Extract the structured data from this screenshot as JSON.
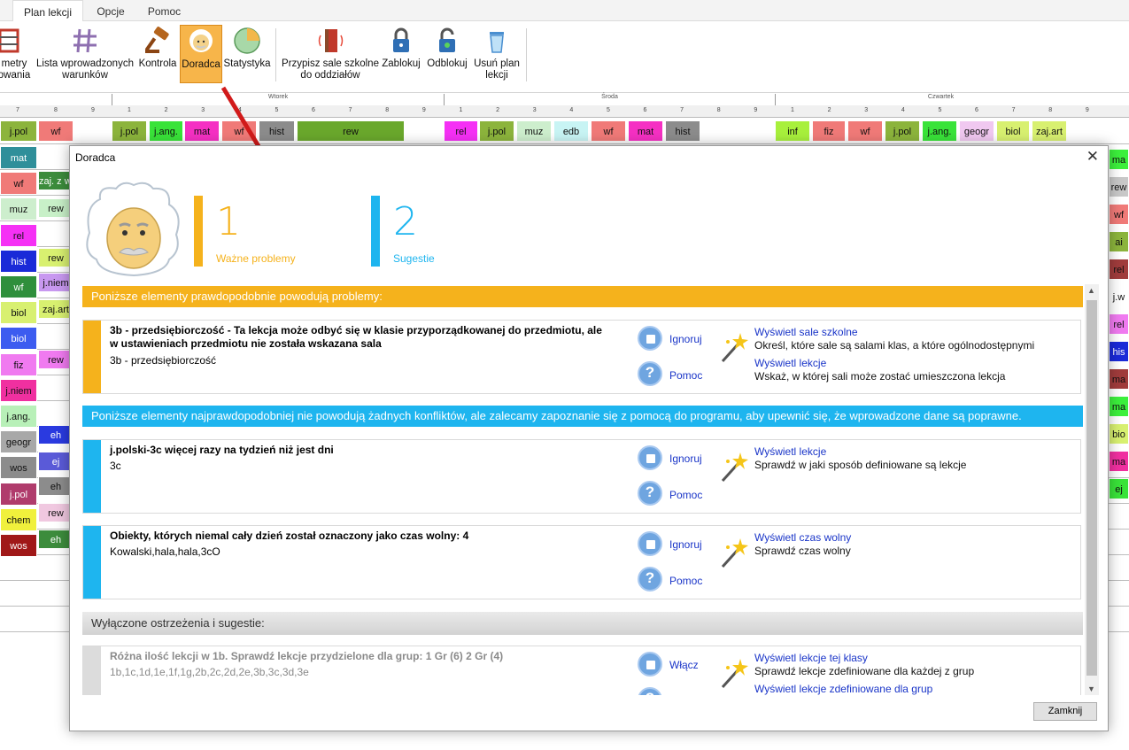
{
  "tabs": [
    "Plan lekcji",
    "Opcje",
    "Pomoc"
  ],
  "ribbon": {
    "params_label_1": "metry",
    "params_label_2": "owania",
    "conditions_label_1": "Lista wprowadzonych",
    "conditions_label_2": "warunków",
    "control_label": "Kontrola",
    "advisor_label": "Doradca",
    "stats_label": "Statystyka",
    "assign_rooms_label_1": "Przypisz sale szkolne",
    "assign_rooms_label_2": "do oddziałów",
    "lock_label": "Zablokuj",
    "unlock_label": "Odblokuj",
    "delete_label_1": "Usuń plan",
    "delete_label_2": "lekcji"
  },
  "grid": {
    "days": [
      "Wtorek",
      "Środa",
      "Czwartek"
    ],
    "row1": [
      {
        "t": "j.pol",
        "c": "#8cb43c"
      },
      {
        "t": "wf",
        "c": "#f07a78"
      },
      {
        "t": "j.pol",
        "c": "#8cb43c"
      },
      {
        "t": "j.ang.",
        "c": "#39e339"
      },
      {
        "t": "mat",
        "c": "#f530c3"
      },
      {
        "t": "wf",
        "c": "#f07a78"
      },
      {
        "t": "hist",
        "c": "#8c8c8c"
      },
      {
        "t": "rew",
        "c": "#6aa82c"
      },
      {
        "t": "rel",
        "c": "#f530f5"
      },
      {
        "t": "j.pol",
        "c": "#8cb43c"
      },
      {
        "t": "muz",
        "c": "#cdeecd"
      },
      {
        "t": "edb",
        "c": "#c8f4f4"
      },
      {
        "t": "wf",
        "c": "#f07a78"
      },
      {
        "t": "mat",
        "c": "#f530c3"
      },
      {
        "t": "hist",
        "c": "#8c8c8c"
      },
      {
        "t": "inf",
        "c": "#a8f03c"
      },
      {
        "t": "fiz",
        "c": "#f07a78"
      },
      {
        "t": "wf",
        "c": "#f07a78"
      },
      {
        "t": "j.pol",
        "c": "#8cb43c"
      },
      {
        "t": "j.ang.",
        "c": "#39e339"
      },
      {
        "t": "geogr",
        "c": "#f0c8f0"
      },
      {
        "t": "biol",
        "c": "#d8f070"
      },
      {
        "t": "zaj.art",
        "c": "#d8f070"
      }
    ],
    "left_col": [
      {
        "t": "mat",
        "c": "#2f8f9a"
      },
      {
        "t": "wf",
        "c": "#f07a78"
      },
      {
        "t": "muz",
        "c": "#cdeecd"
      },
      {
        "t": "rel",
        "c": "#f530f5"
      },
      {
        "t": "hist",
        "c": "#1a2ad8"
      },
      {
        "t": "wf",
        "c": "#2f8f3c"
      },
      {
        "t": "biol",
        "c": "#d8f070"
      },
      {
        "t": "biol",
        "c": "#3c5cf0"
      },
      {
        "t": "fiz",
        "c": "#f07af0"
      },
      {
        "t": "j.niem",
        "c": "#f030a0"
      },
      {
        "t": "j.ang.",
        "c": "#b8f0b8"
      },
      {
        "t": "geogr",
        "c": "#a8a8a8"
      },
      {
        "t": "wos",
        "c": "#8c8c8c"
      },
      {
        "t": "j.pol",
        "c": "#b03c6c"
      },
      {
        "t": "chem",
        "c": "#f0f03c"
      },
      {
        "t": "wos",
        "c": "#a01818"
      }
    ],
    "second_col": [
      {
        "t": "zaj. z wych",
        "c": "#3c8c3c"
      },
      {
        "t": "rew",
        "c": "#c8f0c8"
      },
      {
        "t": "rew",
        "c": "#d8f070"
      },
      {
        "t": "j.niem",
        "c": "#c898f0"
      },
      {
        "t": "zaj.art",
        "c": "#d8f070"
      },
      {
        "t": "rew",
        "c": "#f07af0"
      },
      {
        "t": "eh",
        "c": "#2a3ae0"
      },
      {
        "t": "ej",
        "c": "#5a5ad8"
      },
      {
        "t": "eh",
        "c": "#8c8c8c"
      },
      {
        "t": "rew",
        "c": "#f0c8e0"
      },
      {
        "t": "eh",
        "c": "#3c8c3c"
      }
    ],
    "right_col": [
      "ma",
      "rew",
      "wf",
      "ai",
      "rel",
      "j.w",
      "rel",
      "his",
      "ma",
      "ma",
      "bio",
      "ma",
      "ej"
    ]
  },
  "dialog": {
    "title": "Doradca",
    "stat_important_num": "1",
    "stat_important_label": "Ważne problemy",
    "stat_suggest_num": "2",
    "stat_suggest_label": "Sugestie",
    "section_problems": "Poniższe elementy prawdopodobnie powodują problemy:",
    "section_suggest": "Poniższe elementy najprawdopodobniej nie powodują żadnych konfliktów, ale zalecamy zapoznanie się z pomocą do programu, aby upewnić się, że wprowadzone dane są poprawne.",
    "section_disabled": "Wyłączone ostrzeżenia i sugestie:",
    "cards": [
      {
        "title": "3b - przedsiębiorczość - Ta lekcja może odbyć się w klasie przyporządkowanej do przedmiotu, ale w ustawieniach przedmiotu nie została wskazana sala",
        "sub": "3b - przedsiębiorczość",
        "action1": "Ignoruj",
        "action2": "Pomoc",
        "link1": "Wyświetl sale szkolne",
        "desc1": "Określ, które sale są salami klas, a które ogólnodostępnymi",
        "link2": "Wyświetl lekcje",
        "desc2": "Wskaż, w której sali może zostać umieszczona lekcja"
      },
      {
        "title": "j.polski-3c więcej razy na tydzień niż jest dni",
        "sub": "3c",
        "action1": "Ignoruj",
        "action2": "Pomoc",
        "link1": "Wyświetl lekcje",
        "desc1": "Sprawdź w jaki sposób definiowane są lekcje"
      },
      {
        "title": "Obiekty, których niemal cały dzień został oznaczony jako czas wolny: 4",
        "sub": "Kowalski,hala,hala,3cO",
        "action1": "Ignoruj",
        "action2": "Pomoc",
        "link1": "Wyświetl czas wolny",
        "desc1": "Sprawdź czas wolny"
      },
      {
        "title": "Różna ilość lekcji w 1b. Sprawdź lekcje przydzielone dla grup: 1 Gr (6) 2 Gr (4)",
        "sub": "1b,1c,1d,1e,1f,1g,2b,2c,2d,2e,3b,3c,3d,3e",
        "action1": "Włącz",
        "link1": "Wyświetl lekcje tej klasy",
        "desc1": "Sprawdź lekcje zdefiniowane dla każdej z grup",
        "link2": "Wyświetl lekcje zdefiniowane dla grup"
      }
    ],
    "close_label": "Zamknij"
  },
  "colors": {
    "important": "#f5b21c",
    "suggest": "#1eb5ef",
    "link": "#1a35c8",
    "selected_ribbon": "#f7b54a"
  }
}
